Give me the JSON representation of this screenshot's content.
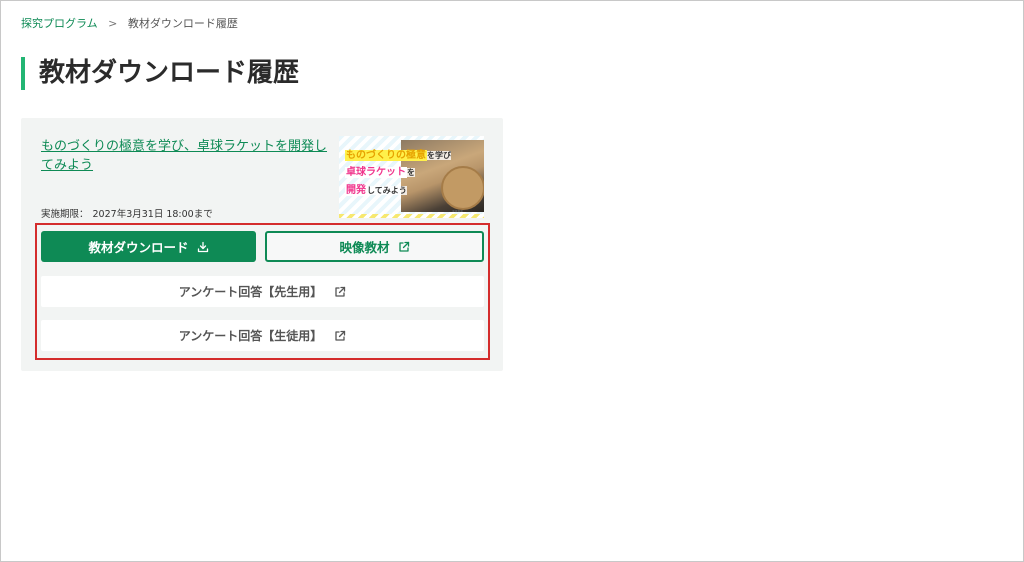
{
  "breadcrumb": {
    "parent": "探究プログラム",
    "separator": ">",
    "current": "教材ダウンロード履歴"
  },
  "page": {
    "title": "教材ダウンロード履歴"
  },
  "card": {
    "title": "ものづくりの極意を学び、卓球ラケットを開発してみよう",
    "deadline_label": "実施期限：",
    "deadline_value": "2027年3月31日 18:00まで",
    "thumbnail": {
      "line1_highlight": "ものづくりの極意",
      "line1_rest": "を学び",
      "line2_highlight": "卓球ラケット",
      "line2_rest": "を",
      "line3_highlight": "開発",
      "line3_rest": "してみよう"
    },
    "buttons": {
      "download": "教材ダウンロード",
      "video": "映像教材",
      "survey_teacher": "アンケート回答【先生用】",
      "survey_student": "アンケート回答【生徒用】"
    }
  },
  "icons": {
    "download": "download-icon",
    "external": "external-link-icon"
  },
  "colors": {
    "accent": "#0e8a55",
    "title_bar": "#22b573",
    "card_bg": "#f2f4f3",
    "highlight_border": "#d42c2c"
  }
}
